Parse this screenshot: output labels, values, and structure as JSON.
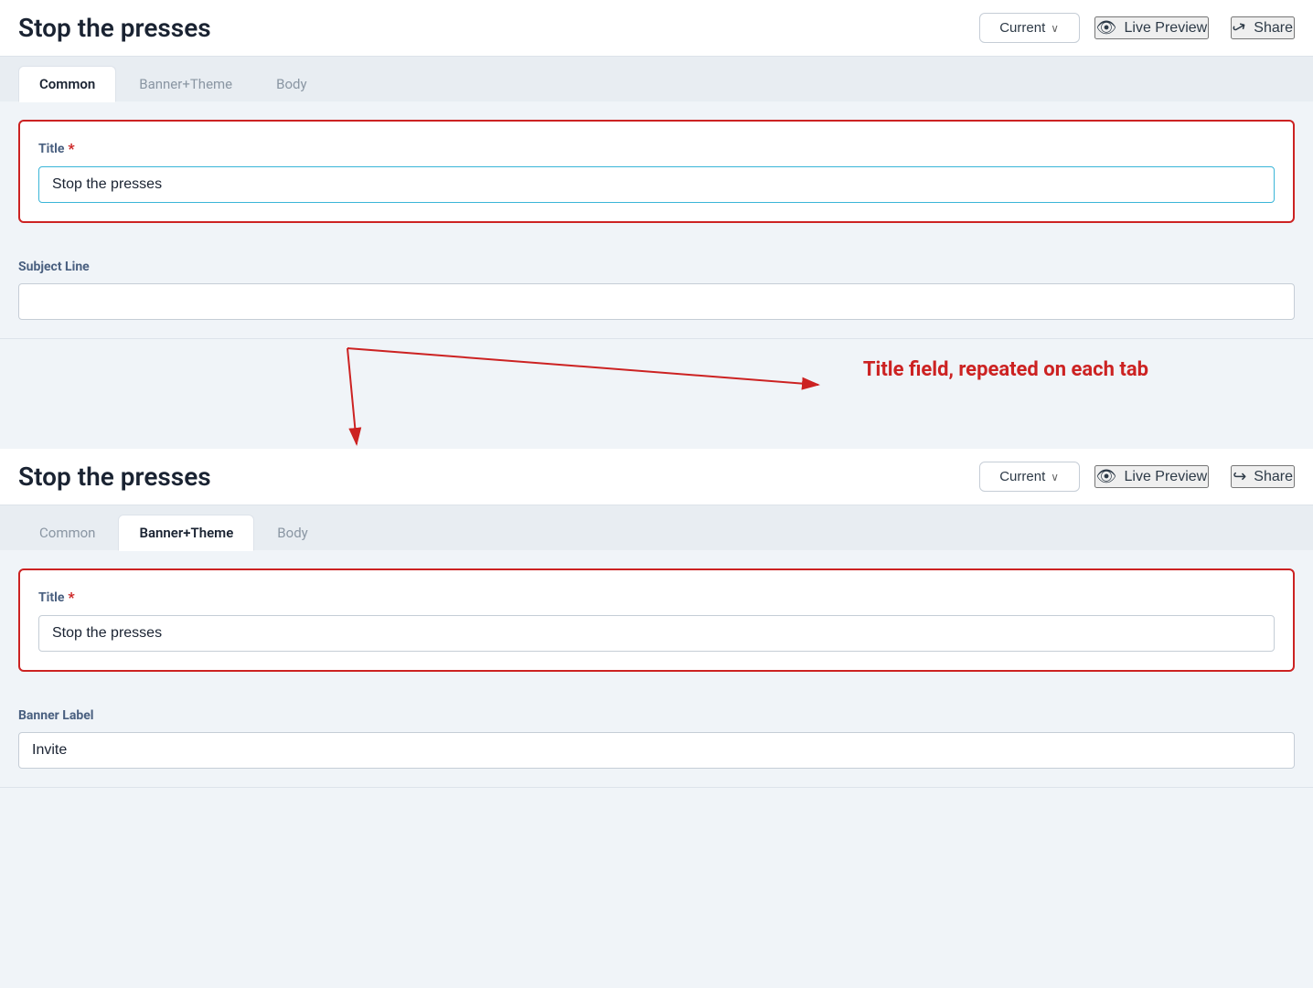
{
  "app": {
    "title": "Stop the presses"
  },
  "top_panel": {
    "title": "Stop the presses",
    "version_label": "Current",
    "chevron": "∨",
    "live_preview_label": "Live Preview",
    "share_label": "Share"
  },
  "bottom_panel": {
    "title": "Stop the presses",
    "version_label": "Current",
    "chevron": "∨",
    "live_preview_label": "Live Preview",
    "share_label": "Share"
  },
  "tabs_top": {
    "items": [
      {
        "id": "common",
        "label": "Common",
        "active": true
      },
      {
        "id": "banner-theme",
        "label": "Banner+Theme",
        "active": false
      },
      {
        "id": "body",
        "label": "Body",
        "active": false
      }
    ]
  },
  "tabs_bottom": {
    "items": [
      {
        "id": "common",
        "label": "Common",
        "active": false
      },
      {
        "id": "banner-theme",
        "label": "Banner+Theme",
        "active": true
      },
      {
        "id": "body",
        "label": "Body",
        "active": false
      }
    ]
  },
  "top_form": {
    "title_label": "Title",
    "title_required": "*",
    "title_value": "Stop the presses",
    "subject_line_label": "Subject Line",
    "subject_line_placeholder": ""
  },
  "bottom_form": {
    "title_label": "Title",
    "title_required": "*",
    "title_value": "Stop the presses",
    "banner_label_label": "Banner Label",
    "banner_label_value": "Invite"
  },
  "annotation": {
    "text": "Title field, repeated on each tab"
  },
  "icons": {
    "eye": "👁",
    "share": "➦"
  }
}
